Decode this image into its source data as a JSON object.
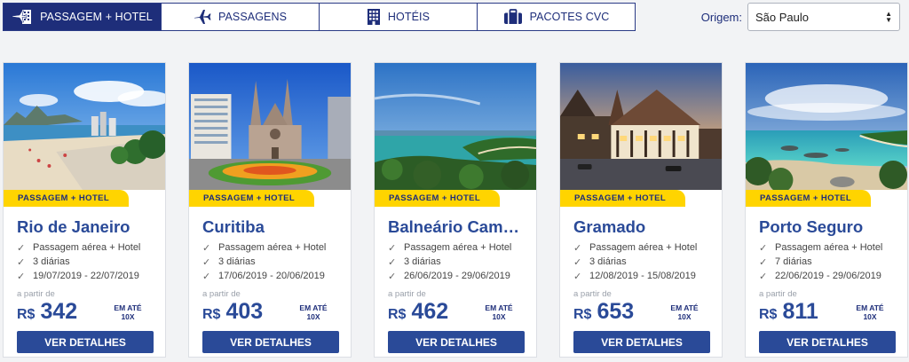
{
  "tabs": [
    {
      "label": "PASSAGEM + HOTEL",
      "icon": "plane-hotel-icon",
      "active": true
    },
    {
      "label": "PASSAGENS",
      "icon": "plane-icon",
      "active": false
    },
    {
      "label": "HOTÉIS",
      "icon": "building-icon",
      "active": false
    },
    {
      "label": "PACOTES CVC",
      "icon": "suitcase-icon",
      "active": false
    }
  ],
  "origin": {
    "label": "Origem:",
    "value": "São Paulo"
  },
  "cards": [
    {
      "badge": "PASSAGEM + HOTEL",
      "destination": "Rio de Janeiro",
      "features": [
        "Passagem aérea + Hotel",
        "3 diárias",
        "19/07/2019 - 22/07/2019"
      ],
      "from_label": "a partir de",
      "currency": "R$",
      "price": "342",
      "installments_line1": "EM ATÉ",
      "installments_line2": "10X",
      "button": "VER DETALHES"
    },
    {
      "badge": "PASSAGEM + HOTEL",
      "destination": "Curitiba",
      "features": [
        "Passagem aérea + Hotel",
        "3 diárias",
        "17/06/2019 - 20/06/2019"
      ],
      "from_label": "a partir de",
      "currency": "R$",
      "price": "403",
      "installments_line1": "EM ATÉ",
      "installments_line2": "10X",
      "button": "VER DETALHES"
    },
    {
      "badge": "PASSAGEM + HOTEL",
      "destination": "Balneário Camboriú",
      "features": [
        "Passagem aérea + Hotel",
        "3 diárias",
        "26/06/2019 - 29/06/2019"
      ],
      "from_label": "a partir de",
      "currency": "R$",
      "price": "462",
      "installments_line1": "EM ATÉ",
      "installments_line2": "10X",
      "button": "VER DETALHES"
    },
    {
      "badge": "PASSAGEM + HOTEL",
      "destination": "Gramado",
      "features": [
        "Passagem aérea + Hotel",
        "3 diárias",
        "12/08/2019 - 15/08/2019"
      ],
      "from_label": "a partir de",
      "currency": "R$",
      "price": "653",
      "installments_line1": "EM ATÉ",
      "installments_line2": "10X",
      "button": "VER DETALHES"
    },
    {
      "badge": "PASSAGEM + HOTEL",
      "destination": "Porto Seguro",
      "features": [
        "Passagem aérea + Hotel",
        "7 diárias",
        "22/06/2019 - 29/06/2019"
      ],
      "from_label": "a partir de",
      "currency": "R$",
      "price": "811",
      "installments_line1": "EM ATÉ",
      "installments_line2": "10X",
      "button": "VER DETALHES"
    }
  ],
  "colors": {
    "brand_blue": "#1e2e7a",
    "accent_yellow": "#ffd400"
  }
}
